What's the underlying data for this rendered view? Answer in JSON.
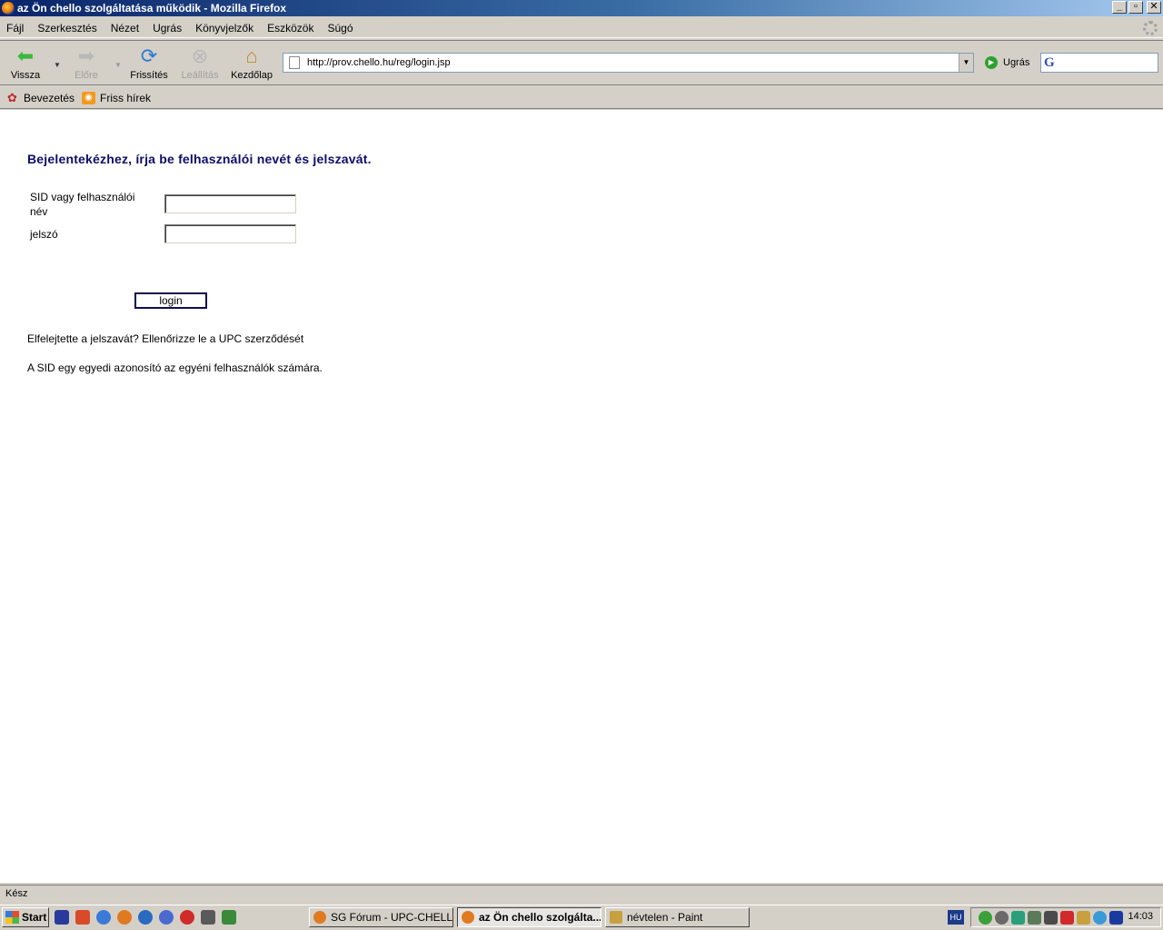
{
  "window": {
    "title": "az Ön chello szolgáltatása működik - Mozilla Firefox",
    "controls": {
      "minimize": "_",
      "maximize": "▫",
      "close": "✕"
    }
  },
  "menu": [
    "Fájl",
    "Szerkesztés",
    "Nézet",
    "Ugrás",
    "Könyvjelzők",
    "Eszközök",
    "Súgó"
  ],
  "toolbar": {
    "back": "Vissza",
    "forward": "Előre",
    "reload": "Frissítés",
    "stop": "Leállítás",
    "home": "Kezdőlap",
    "url": "http://prov.chello.hu/reg/login.jsp",
    "go": "Ugrás",
    "search_engine_letter": "G"
  },
  "bookmarks": [
    {
      "label": "Bevezetés",
      "icon": "firefox-bookmark-icon"
    },
    {
      "label": "Friss hírek",
      "icon": "rss-icon"
    }
  ],
  "page": {
    "heading": "Bejelentekézhez,  írja be felhasználói nevét és jelszavát.",
    "username_label_line1": "SID vagy felhasználói",
    "username_label_line2": "név",
    "password_label": "jelszó",
    "username_value": "",
    "password_value": "",
    "login_button": "login",
    "forgot_text": "Elfelejtette a jelszavát? Ellenőrizze le a UPC szerződését",
    "sid_note": "A SID egy egyedi azonosító az egyéni felhasználók számára."
  },
  "status": "Kész",
  "taskbar": {
    "start": "Start",
    "tasks": [
      {
        "label": "SG Fórum - UPC-CHELLO...",
        "active": false
      },
      {
        "label": "az Ön chello szolgálta...",
        "active": true
      },
      {
        "label": "névtelen - Paint",
        "active": false
      }
    ],
    "language": "HU",
    "clock": "14:03"
  },
  "colors": {
    "heading": "#0d0d6b",
    "titlebar_start": "#0a246a",
    "chrome": "#d4d0c8"
  }
}
